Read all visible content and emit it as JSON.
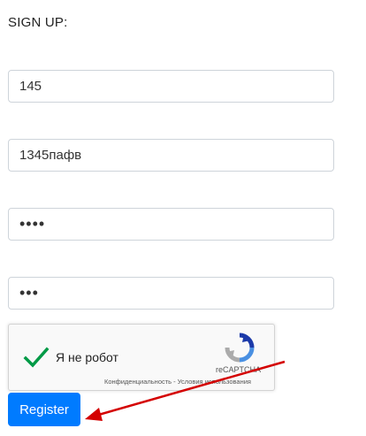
{
  "form": {
    "title": "SIGN UP:",
    "fields": [
      {
        "value": "145"
      },
      {
        "value": "1345пафв"
      },
      {
        "value": "••••"
      },
      {
        "value": "•••"
      }
    ],
    "register_label": "Register"
  },
  "captcha": {
    "label": "Я не робот",
    "brand": "reCAPTCHA",
    "links": "Конфиденциальность - Условия использования",
    "check_color": "#009a46"
  },
  "colors": {
    "primary": "#007bff",
    "annotation_arrow": "#d40000"
  },
  "icons": [
    "checkmark-icon",
    "recaptcha-logo-icon",
    "annotation-arrow"
  ]
}
